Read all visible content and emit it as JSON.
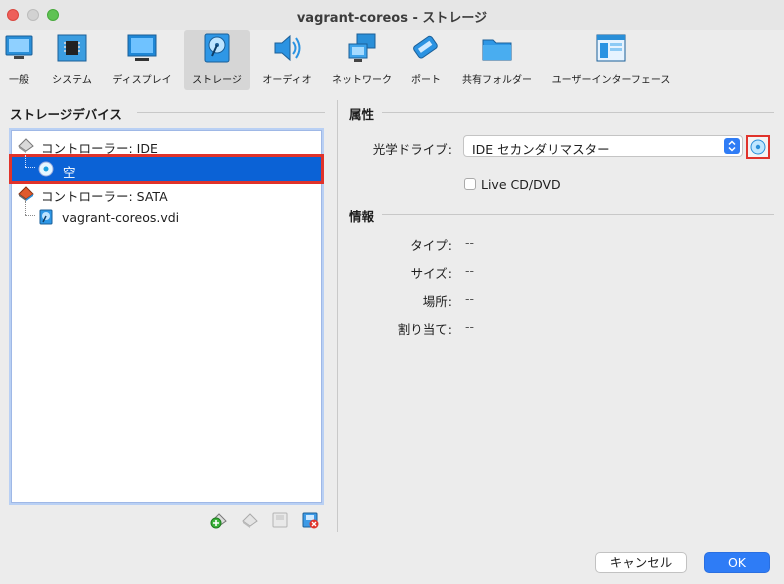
{
  "window": {
    "title": "vagrant-coreos - ストレージ"
  },
  "toolbar": {
    "items": [
      {
        "label": "一般",
        "icon": "monitor-icon"
      },
      {
        "label": "システム",
        "icon": "chip-icon"
      },
      {
        "label": "ディスプレイ",
        "icon": "display-icon"
      },
      {
        "label": "ストレージ",
        "icon": "storage-disk-icon",
        "selected": true
      },
      {
        "label": "オーディオ",
        "icon": "speaker-icon"
      },
      {
        "label": "ネットワーク",
        "icon": "network-icon"
      },
      {
        "label": "ポート",
        "icon": "port-icon"
      },
      {
        "label": "共有フォルダー",
        "icon": "folder-icon"
      },
      {
        "label": "ユーザーインターフェース",
        "icon": "ui-window-icon"
      }
    ]
  },
  "left": {
    "heading": "ストレージデバイス",
    "tree": [
      {
        "label": "コントローラー: IDE",
        "icon": "ide-controller-icon"
      },
      {
        "label": "空",
        "icon": "optical-disc-icon",
        "selected": true
      },
      {
        "label": "コントローラー: SATA",
        "icon": "sata-controller-icon"
      },
      {
        "label": "vagrant-coreos.vdi",
        "icon": "hard-disk-icon"
      }
    ]
  },
  "right": {
    "attributes_heading": "属性",
    "optical_drive_label": "光学ドライブ:",
    "optical_drive_value": "IDE セカンダリマスター",
    "live_cd_label": "Live CD/DVD",
    "info_heading": "情報",
    "info": [
      {
        "label": "タイプ:",
        "value": "--"
      },
      {
        "label": "サイズ:",
        "value": "--"
      },
      {
        "label": "場所:",
        "value": "--"
      },
      {
        "label": "割り当て:",
        "value": "--"
      }
    ]
  },
  "buttons": {
    "cancel": "キャンセル",
    "ok": "OK"
  },
  "colors": {
    "accent": "#2e7cf6",
    "selection": "#0b62d6",
    "highlight_box": "#e0332b"
  }
}
